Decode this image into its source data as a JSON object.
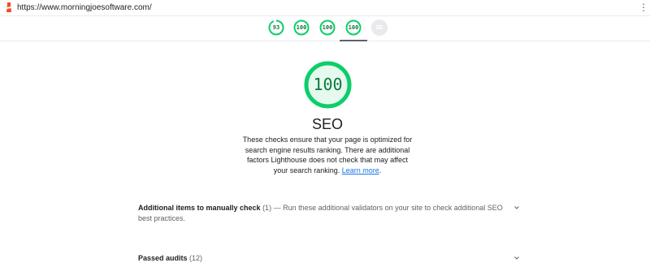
{
  "browser": {
    "url": "https://www.morningjoesoftware.com/",
    "menu_icon": "kebab-menu-icon"
  },
  "gauges": [
    {
      "label": "93",
      "score": 0.93,
      "color": "#0cce6b"
    },
    {
      "label": "100",
      "score": 1.0,
      "color": "#0cce6b"
    },
    {
      "label": "100",
      "score": 1.0,
      "color": "#0cce6b"
    },
    {
      "label": "100",
      "score": 1.0,
      "color": "#0cce6b",
      "active": true
    }
  ],
  "pwa_icon": "pwa-badge-icon",
  "category": {
    "score": "100",
    "title": "SEO",
    "description": "These checks ensure that your page is optimized for search engine results ranking. There are additional factors Lighthouse does not check that may affect your search ranking.",
    "learn_more": "Learn more",
    "period": "."
  },
  "groups": [
    {
      "title": "Additional items to manually check",
      "count": "(1)",
      "description": "— Run these additional validators on your site to check additional SEO best practices."
    },
    {
      "title": "Passed audits",
      "count": "(12)",
      "description": ""
    }
  ],
  "colors": {
    "pass": "#0cce6b",
    "pass_text": "#0b7a3e",
    "link": "#1a73e8"
  }
}
